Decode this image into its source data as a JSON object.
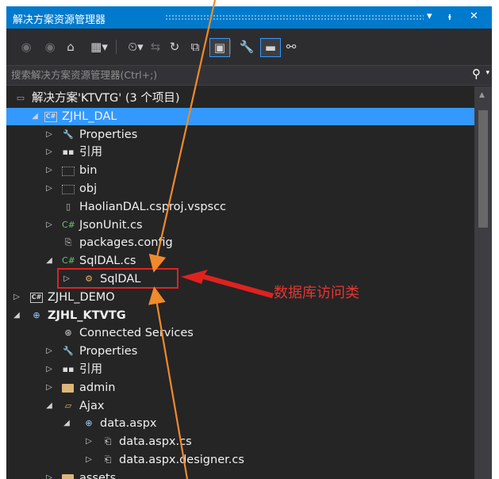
{
  "panel": {
    "title": "解决方案资源管理器",
    "dropdown_glyph": "▾",
    "pin_glyph": "ᵼ",
    "close_glyph": "✕"
  },
  "search": {
    "placeholder": "搜索解决方案资源管理器(Ctrl+;)",
    "icon_glyph": "⚲",
    "dropdown_glyph": "▾"
  },
  "toolbar": {
    "items": [
      {
        "name": "back-icon",
        "glyph": "◉"
      },
      {
        "name": "forward-icon",
        "glyph": "◉"
      },
      {
        "name": "home-icon",
        "glyph": "⌂"
      },
      {
        "name": "switch-views-icon",
        "glyph": "▦▾"
      },
      {
        "name": "pending-changes-icon",
        "glyph": "⏲▾"
      },
      {
        "name": "sync-icon",
        "glyph": "⇆"
      },
      {
        "name": "refresh-icon",
        "glyph": "↻"
      },
      {
        "name": "collapse-all-icon",
        "glyph": "⧉"
      },
      {
        "name": "show-all-files-icon",
        "glyph": "▣"
      },
      {
        "name": "properties-icon",
        "glyph": "🔧"
      },
      {
        "name": "preview-icon",
        "glyph": "▬"
      },
      {
        "name": "class-view-icon",
        "glyph": "⚯"
      }
    ]
  },
  "tree": [
    {
      "label": "解决方案'KTVTG' (3 个项目)",
      "level": 0,
      "arrow": "",
      "icon": "solution"
    },
    {
      "label": "ZJHL_DAL",
      "level": 1,
      "arrow": "◢",
      "icon": "csproj",
      "selected": true
    },
    {
      "label": "Properties",
      "level": 2,
      "arrow": "▷",
      "icon": "wrench"
    },
    {
      "label": "引用",
      "level": 2,
      "arrow": "▷",
      "icon": "references"
    },
    {
      "label": "bin",
      "level": 2,
      "arrow": "▷",
      "icon": "folder-ghost"
    },
    {
      "label": "obj",
      "level": 2,
      "arrow": "▷",
      "icon": "folder-ghost"
    },
    {
      "label": "HaolianDAL.csproj.vspscc",
      "level": 2,
      "arrow": "",
      "icon": "file"
    },
    {
      "label": "JsonUnit.cs",
      "level": 2,
      "arrow": "▷",
      "icon": "cs"
    },
    {
      "label": "packages.config",
      "level": 2,
      "arrow": "",
      "icon": "config"
    },
    {
      "label": "SqlDAL.cs",
      "level": 2,
      "arrow": "◢",
      "icon": "cs"
    },
    {
      "label": "SqlDAL",
      "level": 3,
      "arrow": "▷",
      "icon": "class"
    },
    {
      "label": "ZJHL_DEMO",
      "level": 0,
      "arrow": "▷",
      "icon": "csproj"
    },
    {
      "label": "ZJHL_KTVTG",
      "level": 0,
      "arrow": "◢",
      "icon": "web",
      "bold": true
    },
    {
      "label": "Connected Services",
      "level": 2,
      "arrow": "",
      "icon": "connected"
    },
    {
      "label": "Properties",
      "level": 2,
      "arrow": "▷",
      "icon": "wrench"
    },
    {
      "label": "引用",
      "level": 2,
      "arrow": "▷",
      "icon": "references"
    },
    {
      "label": "admin",
      "level": 2,
      "arrow": "▷",
      "icon": "folder"
    },
    {
      "label": "Ajax",
      "level": 2,
      "arrow": "◢",
      "icon": "folder-open"
    },
    {
      "label": "data.aspx",
      "level": 3,
      "arrow": "◢",
      "icon": "aspx"
    },
    {
      "label": "data.aspx.cs",
      "level": 4,
      "arrow": "▷",
      "icon": "code"
    },
    {
      "label": "data.aspx.designer.cs",
      "level": 4,
      "arrow": "▷",
      "icon": "code"
    },
    {
      "label": "assets",
      "level": 2,
      "arrow": "▷",
      "icon": "folder"
    }
  ],
  "annotation": {
    "text": "数据库访问类",
    "color": "#e8342e"
  },
  "colors": {
    "accent": "#007acc",
    "selection": "#3399ff",
    "background": "#252526",
    "annotation_arrow": "#e0221f",
    "pointer_line": "#f08a2a",
    "cs_green": "#68c46a"
  }
}
